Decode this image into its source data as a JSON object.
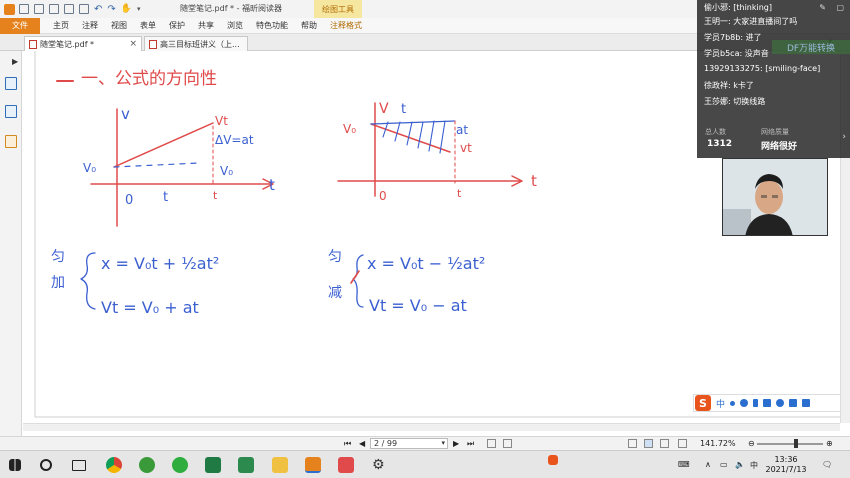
{
  "app": {
    "document_title": "随堂笔记.pdf * - 福昕阅读器",
    "context_tab": "绘图工具",
    "menus": [
      "文件",
      "主页",
      "注释",
      "视图",
      "表单",
      "保护",
      "共享",
      "浏览",
      "特色功能",
      "帮助",
      "注释格式"
    ],
    "tabs": [
      {
        "label": "随堂笔记.pdf *",
        "active": true
      },
      {
        "label": "高三目标班讲义（上...",
        "active": false
      }
    ]
  },
  "note": {
    "heading": "一、公式的方向性",
    "left_graph": {
      "v_axis": "v",
      "t_axis": "t",
      "origin": "0",
      "v0": "V₀",
      "vt": "Vt",
      "t_label": "t",
      "t_tick": "t",
      "delta_v": "ΔV=at",
      "v0_right": "V₀"
    },
    "right_graph": {
      "v_axis": "V",
      "t_axis": "t",
      "origin": "0",
      "v0": "V₀",
      "t_label": "t",
      "at": "at",
      "vt": "vt",
      "t_tick": "t"
    },
    "accel_label_1": "匀",
    "accel_label_2": "加",
    "accel_eq_1": "x = V₀t + ½at²",
    "accel_eq_2": "Vt = V₀ + at",
    "decel_label_1": "匀",
    "decel_label_2": "减",
    "decel_eq_1": "x = V₀t − ½at²",
    "decel_eq_2": "Vt = V₀ − at"
  },
  "status": {
    "page": "2 / 99",
    "zoom": "141.72%"
  },
  "chat": {
    "messages": [
      {
        "user": "偷小邪",
        "text": "[thinking]"
      },
      {
        "user": "王明一",
        "text": "大家进直播间了吗"
      },
      {
        "user": "学员7b8b",
        "text": "进了"
      },
      {
        "user": "学员b5ca",
        "text": "没声音"
      },
      {
        "user": "13929133275",
        "text": "[smiling-face]"
      },
      {
        "user": "徐政祥",
        "text": "k卡了"
      },
      {
        "user": "王莎娜",
        "text": "切换线路"
      }
    ],
    "total_label": "总人数",
    "total_value": "1312",
    "network_label": "网络质量",
    "network_value": "网络很好",
    "pdf_badge": "DF万能转换"
  },
  "ime": {
    "label": "中"
  },
  "taskbar": {
    "time": "13:36",
    "date": "2021/7/13"
  },
  "colors": {
    "accent_orange": "#e5821d",
    "ink_red": "#e04a4a",
    "ink_blue": "#3a5fd0",
    "sogou": "#e8541b"
  }
}
